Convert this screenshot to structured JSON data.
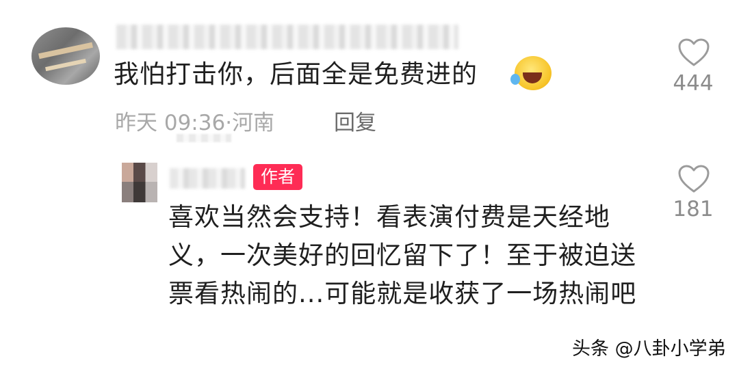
{
  "comments": [
    {
      "text": "我怕打击你，后面全是免费进的",
      "emoji": "rolling-on-floor-laughing-emoji",
      "time": "昨天 09:36",
      "location": "河南",
      "reply_label": "回复",
      "likes": "444"
    },
    {
      "badge": "作者",
      "text": "喜欢当然会支持！看表演付费是天经地义，一次美好的回忆留下了！至于被迫送票看热闹的...可能就是收获了一场热闹吧",
      "likes": "181"
    }
  ],
  "watermark": "头条 @八卦小学弟",
  "colors": {
    "author_badge": "#fe2c55",
    "meta_text": "#a8a8a8",
    "count_text": "#8c8c8c"
  }
}
